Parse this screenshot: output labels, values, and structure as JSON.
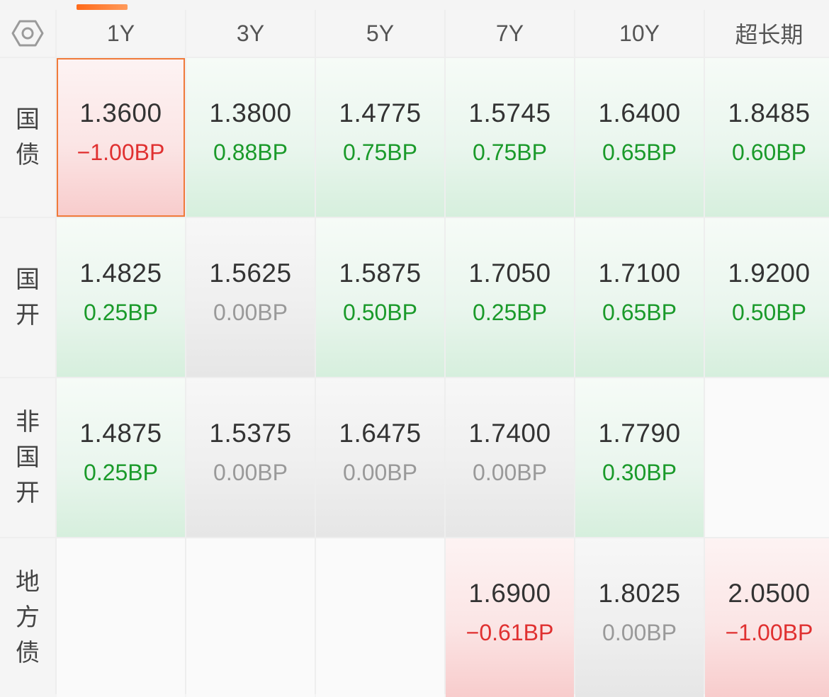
{
  "header": {
    "columns": [
      "1Y",
      "3Y",
      "5Y",
      "7Y",
      "10Y",
      "超长期"
    ]
  },
  "rows": [
    {
      "label": [
        "国",
        "债"
      ],
      "cells": [
        {
          "value": "1.3600",
          "change": "−1.00BP",
          "tone": "r",
          "selected": true
        },
        {
          "value": "1.3800",
          "change": "0.88BP",
          "tone": "g"
        },
        {
          "value": "1.4775",
          "change": "0.75BP",
          "tone": "g"
        },
        {
          "value": "1.5745",
          "change": "0.75BP",
          "tone": "g"
        },
        {
          "value": "1.6400",
          "change": "0.65BP",
          "tone": "g"
        },
        {
          "value": "1.8485",
          "change": "0.60BP",
          "tone": "g"
        }
      ]
    },
    {
      "label": [
        "国",
        "开"
      ],
      "cells": [
        {
          "value": "1.4825",
          "change": "0.25BP",
          "tone": "g"
        },
        {
          "value": "1.5625",
          "change": "0.00BP",
          "tone": "n"
        },
        {
          "value": "1.5875",
          "change": "0.50BP",
          "tone": "g"
        },
        {
          "value": "1.7050",
          "change": "0.25BP",
          "tone": "g"
        },
        {
          "value": "1.7100",
          "change": "0.65BP",
          "tone": "g"
        },
        {
          "value": "1.9200",
          "change": "0.50BP",
          "tone": "g"
        }
      ]
    },
    {
      "label": [
        "非",
        "国",
        "开"
      ],
      "cells": [
        {
          "value": "1.4875",
          "change": "0.25BP",
          "tone": "g"
        },
        {
          "value": "1.5375",
          "change": "0.00BP",
          "tone": "n"
        },
        {
          "value": "1.6475",
          "change": "0.00BP",
          "tone": "n"
        },
        {
          "value": "1.7400",
          "change": "0.00BP",
          "tone": "n"
        },
        {
          "value": "1.7790",
          "change": "0.30BP",
          "tone": "g"
        },
        {
          "value": "",
          "change": "",
          "tone": "e"
        }
      ]
    },
    {
      "label": [
        "地",
        "方",
        "债"
      ],
      "cells": [
        {
          "value": "",
          "change": "",
          "tone": "e"
        },
        {
          "value": "",
          "change": "",
          "tone": "e"
        },
        {
          "value": "",
          "change": "",
          "tone": "e"
        },
        {
          "value": "1.6900",
          "change": "−0.61BP",
          "tone": "r"
        },
        {
          "value": "1.8025",
          "change": "0.00BP",
          "tone": "n"
        },
        {
          "value": "2.0500",
          "change": "−1.00BP",
          "tone": "r"
        }
      ]
    }
  ],
  "colors": {
    "up": "#e03030",
    "down": "#1a9a2a",
    "flat": "#999999",
    "accent": "#f07a3a"
  },
  "icons": {
    "corner": "settings-hexagon-icon"
  }
}
